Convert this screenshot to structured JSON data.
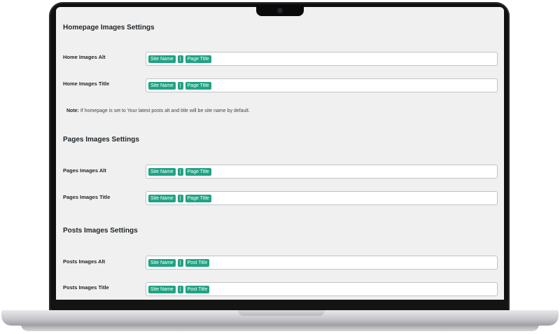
{
  "homepage": {
    "title": "Homepage Images Settings",
    "fields": [
      {
        "label": "Home Images Alt",
        "tags": [
          "Site Name",
          "|",
          "Page Title"
        ]
      },
      {
        "label": "Home Images Title",
        "tags": [
          "Site Name",
          "|",
          "Page Title"
        ]
      }
    ],
    "note_label": "Note:",
    "note_text": "If homepage is set to Your latest posts alt and title will be site name by default."
  },
  "pages": {
    "title": "Pages Images Settings",
    "fields": [
      {
        "label": "Pages Images Alt",
        "tags": [
          "Site Name",
          "|",
          "Page Title"
        ]
      },
      {
        "label": "Pages Images Title",
        "tags": [
          "Site Name",
          "|",
          "Page Title"
        ]
      }
    ]
  },
  "posts": {
    "title": "Posts Images Settings",
    "fields": [
      {
        "label": "Posts Images Alt",
        "tags": [
          "Site Name",
          "|",
          "Post Title"
        ]
      },
      {
        "label": "Posts Images Title",
        "tags": [
          "Site Name",
          "|",
          "Post Title"
        ]
      }
    ]
  },
  "colors": {
    "tag_bg": "#1fa383",
    "screen_bg": "#f0f0f0"
  }
}
